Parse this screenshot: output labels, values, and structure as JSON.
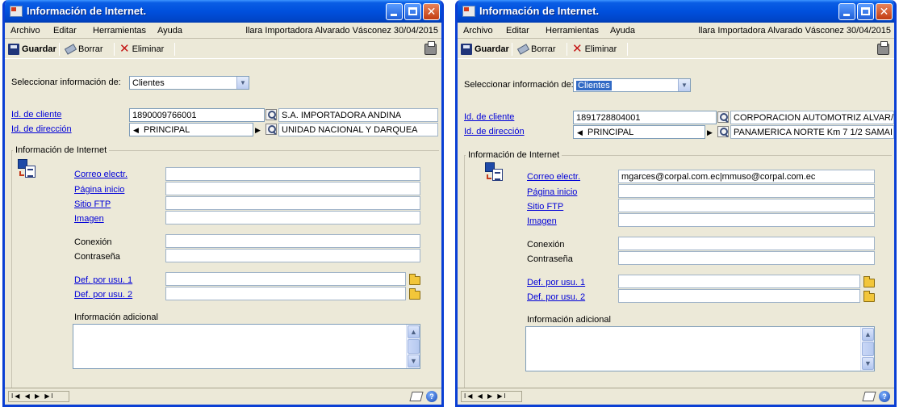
{
  "windows": [
    {
      "title": "Información de Internet.",
      "menu": {
        "items": [
          "Archivo",
          "Editar",
          "Herramientas",
          "Ayuda"
        ],
        "info": "llara  Importadora Alvarado Vásconez  30/04/2015"
      },
      "toolbar": {
        "save": "Guardar",
        "erase": "Borrar",
        "delete": "Eliminar"
      },
      "select": {
        "label": "Seleccionar información de:",
        "value": "Clientes"
      },
      "client": {
        "label": "Id. de cliente",
        "id": "1890009766001",
        "name": "S.A. IMPORTADORA ANDINA"
      },
      "address": {
        "label": "Id. de dirección",
        "id": "PRINCIPAL",
        "name": "UNIDAD NACIONAL Y DARQUEA"
      },
      "group": {
        "title": "Información de Internet"
      },
      "fields": {
        "email_label": "Correo electr.",
        "email_value": "",
        "home_label": "Página inicio",
        "home_value": "",
        "ftp_label": "Sitio FTP",
        "ftp_value": "",
        "image_label": "Imagen",
        "image_value": "",
        "conn_label": "Conexión",
        "conn_value": "",
        "pass_label": "Contraseña",
        "pass_value": "",
        "user1_label": "Def. por usu. 1",
        "user1_value": "",
        "user2_label": "Def. por usu. 2",
        "user2_value": "",
        "additional_label": "Información adicional"
      }
    },
    {
      "title": "Información de Internet.",
      "menu": {
        "items": [
          "Archivo",
          "Editar",
          "Herramientas",
          "Ayuda"
        ],
        "info": "llara  Importadora Alvarado Vásconez  30/04/2015"
      },
      "toolbar": {
        "save": "Guardar",
        "erase": "Borrar",
        "delete": "Eliminar"
      },
      "select": {
        "label": "Seleccionar información de:",
        "value": "Clientes"
      },
      "client": {
        "label": "Id. de cliente",
        "id": "1891728804001",
        "name": "CORPORACION AUTOMOTRIZ ALVAR/"
      },
      "address": {
        "label": "Id. de dirección",
        "id": "PRINCIPAL",
        "name": "PANAMERICA NORTE Km 7 1/2 SAMAI"
      },
      "group": {
        "title": "Información de Internet"
      },
      "fields": {
        "email_label": "Correo electr.",
        "email_value": "mgarces@corpal.com.ec|mmuso@corpal.com.ec",
        "home_label": "Página inicio",
        "home_value": "",
        "ftp_label": "Sitio FTP",
        "ftp_value": "",
        "image_label": "Imagen",
        "image_value": "",
        "conn_label": "Conexión",
        "conn_value": "",
        "pass_label": "Contraseña",
        "pass_value": "",
        "user1_label": "Def. por usu. 1",
        "user1_value": "",
        "user2_label": "Def. por usu. 2",
        "user2_value": "",
        "additional_label": "Información adicional"
      }
    }
  ],
  "statusbar": {
    "nav": "I◀ ◀ ▶ ▶I"
  },
  "colors": {
    "titlebar": "#0054e3",
    "link": "#0000d8",
    "window_bg": "#ece9d8",
    "selection": "#316ac5"
  }
}
